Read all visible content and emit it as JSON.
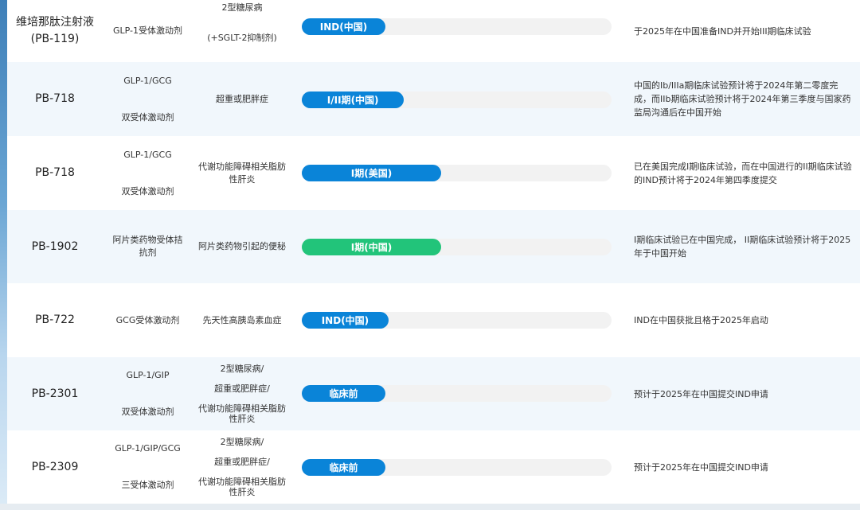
{
  "colors": {
    "blue": "#0a84d8",
    "green": "#22c47a",
    "track": "#f2f2f2"
  },
  "rows": [
    {
      "name": "维培那肽注射液\n(PB-119)",
      "target": [
        "GLP-1受体激动剂"
      ],
      "indication": [
        "2型糖尿病",
        "(+SGLT-2抑制剂)"
      ],
      "stage": "IND(中国)",
      "progress": 0.27,
      "color": "blue",
      "status": "于2025年在中国准备IND并开始III期临床试验"
    },
    {
      "name": "PB-718",
      "target": [
        "GLP-1/GCG",
        "双受体激动剂"
      ],
      "indication": [
        "超重或肥胖症"
      ],
      "stage": "I/II期(中国)",
      "progress": 0.33,
      "color": "blue",
      "status": "中国的Ib/IIIa期临床试验预计将于2024年第二零度完成，而IIb期临床试验预计将于2024年第三季度与国家药监局沟通后在中国开始"
    },
    {
      "name": "PB-718",
      "target": [
        "GLP-1/GCG",
        "双受体激动剂"
      ],
      "indication": [
        "代谢功能障碍相关脂肪",
        "性肝炎"
      ],
      "stage": "I期(美国)",
      "progress": 0.45,
      "color": "blue",
      "status": "已在美国完成I期临床试验，而在中国进行的II期临床试验的IND预计将于2024年第四季度提交"
    },
    {
      "name": "PB-1902",
      "target": [
        "阿片类药物受体拮",
        "抗剂"
      ],
      "indication": [
        "阿片类药物引起的便秘"
      ],
      "stage": "I期(中国)",
      "progress": 0.45,
      "color": "green",
      "status": "I期临床试验已在中国完成， II期临床试验预计将于2025年于中国开始"
    },
    {
      "name": "PB-722",
      "target": [
        "GCG受体激动剂"
      ],
      "indication": [
        "先天性高胰岛素血症"
      ],
      "stage": "IND(中国)",
      "progress": 0.28,
      "color": "blue",
      "status": "IND在中国获批且格于2025年启动"
    },
    {
      "name": "PB-2301",
      "target": [
        "GLP-1/GIP",
        "双受体激动剂"
      ],
      "indication": [
        "2型糖尿病/",
        "超重或肥胖症/",
        "代谢功能障碍相关脂肪",
        "性肝炎"
      ],
      "stage": "临床前",
      "progress": 0.27,
      "color": "blue",
      "status": "预计于2025年在中国提交IND申请"
    },
    {
      "name": "PB-2309",
      "target": [
        "GLP-1/GIP/GCG",
        "三受体激动剂"
      ],
      "indication": [
        "2型糖尿病/",
        "超重或肥胖症/",
        "代谢功能障碍相关脂肪",
        "性肝炎"
      ],
      "stage": "临床前",
      "progress": 0.27,
      "color": "blue",
      "status": "预计于2025年在中国提交IND申请"
    }
  ]
}
